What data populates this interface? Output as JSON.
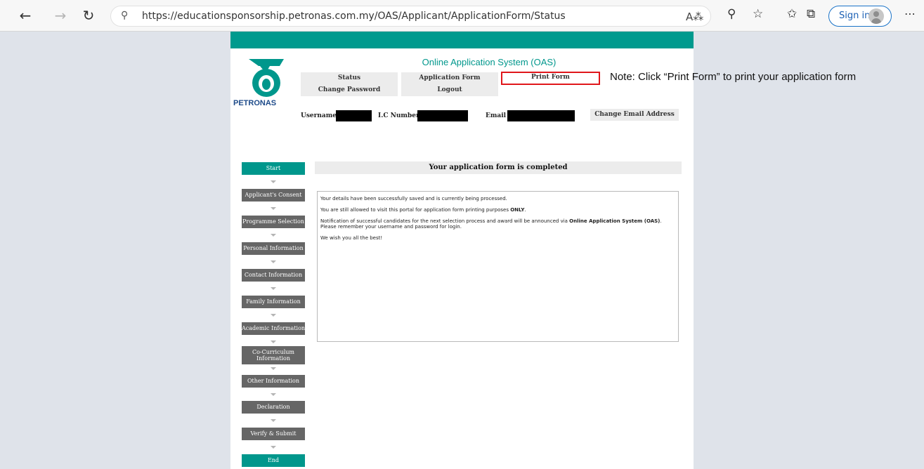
{
  "browser": {
    "url": "https://educationsponsorship.petronas.com.my/OAS/Applicant/ApplicationForm/Status",
    "sign_in_label": "Sign in",
    "icons": [
      "back-icon",
      "forward-icon",
      "refresh-icon",
      "lock-icon",
      "read-aloud-icon",
      "zoom-icon",
      "add-favorite-icon",
      "favorites-icon",
      "collections-icon",
      "more-icon"
    ]
  },
  "header": {
    "brand": "PETRONAS",
    "system_title": "Online Application System (OAS)",
    "accent_color": "#00978c"
  },
  "menu": {
    "status": "Status",
    "application_form": "Application Form",
    "print_form": "Print Form",
    "change_password": "Change Password",
    "logout": "Logout",
    "change_email": "Change Email Address"
  },
  "user_info": {
    "username_label": "Username :",
    "ic_label": "I.C Number :",
    "email_label": "Email :"
  },
  "steps": [
    {
      "label": "Start",
      "active": true
    },
    {
      "label": "Applicant's Consent",
      "active": false
    },
    {
      "label": "Programme Selection",
      "active": false
    },
    {
      "label": "Personal Information",
      "active": false
    },
    {
      "label": "Contact Information",
      "active": false
    },
    {
      "label": "Family Information",
      "active": false
    },
    {
      "label": "Academic Information",
      "active": false
    },
    {
      "label": "Co-Curriculum Information",
      "active": false
    },
    {
      "label": "Other Information",
      "active": false
    },
    {
      "label": "Declaration",
      "active": false
    },
    {
      "label": "Verify & Submit",
      "active": false
    },
    {
      "label": "End",
      "active": true
    }
  ],
  "main": {
    "completed_title": "Your application form is completed",
    "msg1": "Your details have been successfully saved and is currently being processed.",
    "msg2_prefix": "You are still allowed to visit this portal for application form printing purposes ",
    "msg2_bold": "ONLY",
    "msg2_suffix": ".",
    "msg3_prefix": "Notification of successful candidates for the next selection process and award will be announced via ",
    "msg3_bold": "Online Application System (OAS)",
    "msg3_suffix": ". Please remember your username and password for login.",
    "msg4": "We wish you all the best!"
  },
  "annotation": {
    "note": "Note: Click “Print Form” to print your application form",
    "highlight_color": "#e0161b"
  }
}
